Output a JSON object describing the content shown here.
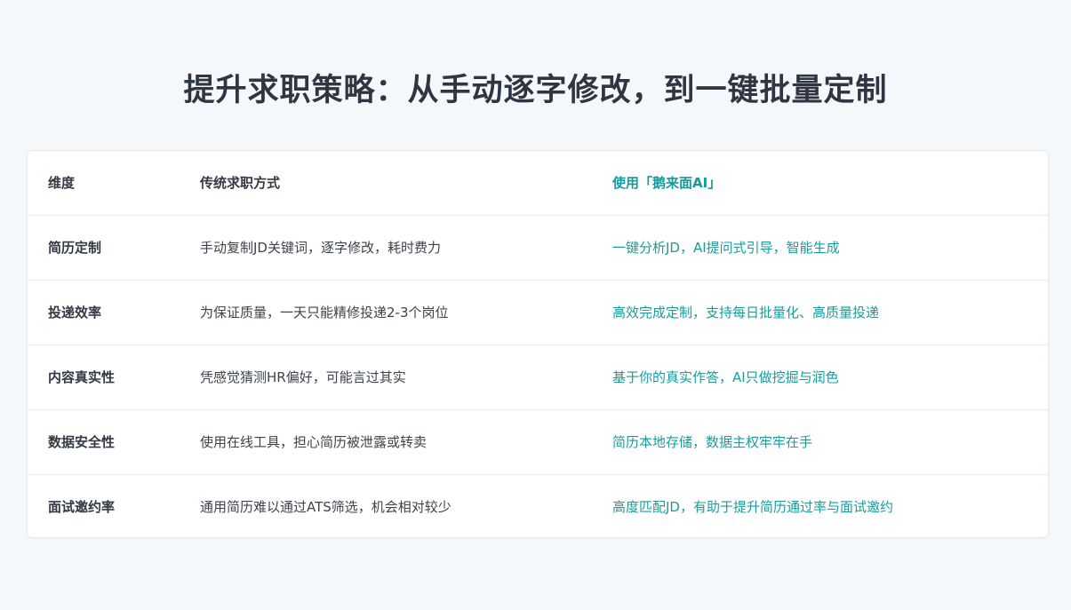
{
  "title": "提升求职策略：从手动逐字修改，到一键批量定制",
  "table": {
    "headers": [
      "维度",
      "传统求职方式",
      "使用「鹅来面AI」"
    ],
    "rows": [
      [
        "简历定制",
        "手动复制JD关键词，逐字修改，耗时费力",
        "一键分析JD，AI提问式引导，智能生成"
      ],
      [
        "投递效率",
        "为保证质量，一天只能精修投递2-3个岗位",
        "高效完成定制，支持每日批量化、高质量投递"
      ],
      [
        "内容真实性",
        "凭感觉猜测HR偏好，可能言过其实",
        "基于你的真实作答，AI只做挖掘与润色"
      ],
      [
        "数据安全性",
        "使用在线工具，担心简历被泄露或转卖",
        "简历本地存储，数据主权牢牢在手"
      ],
      [
        "面试邀约率",
        "通用简历难以通过ATS筛选，机会相对较少",
        "高度匹配JD，有助于提升简历通过率与面试邀约"
      ]
    ]
  },
  "colors": {
    "accent": "#1a9c9c",
    "text": "#333a44",
    "background": "#f5f8fa"
  }
}
